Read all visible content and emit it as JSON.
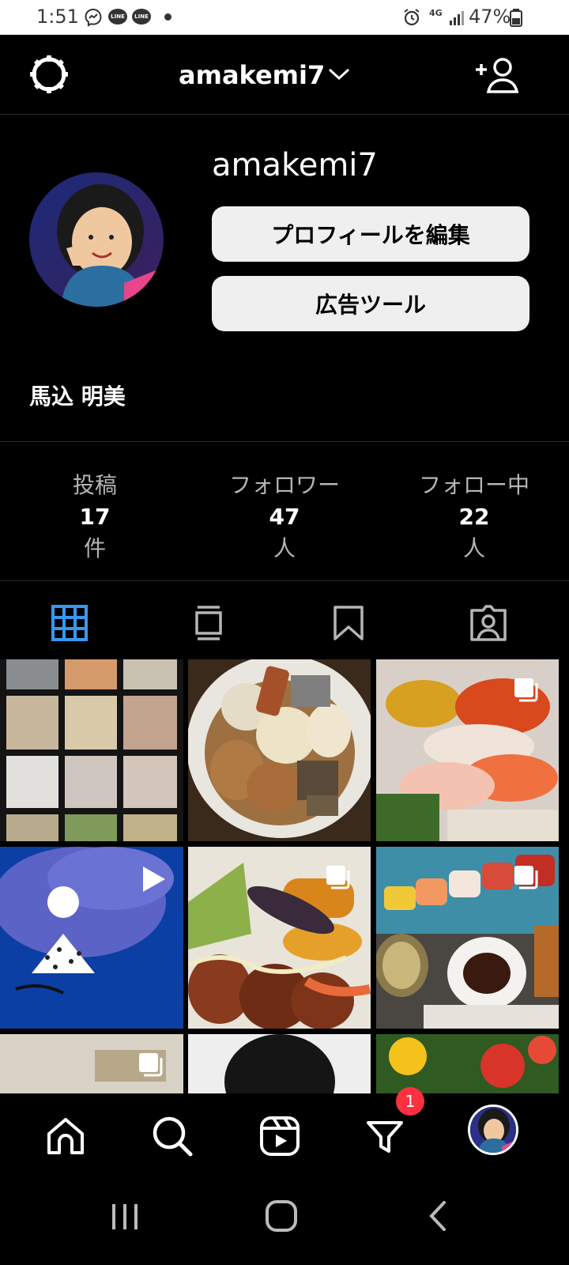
{
  "status_bar": {
    "time": "1:51",
    "notification_icons": [
      "messenger-icon",
      "line-icon",
      "line-icon"
    ],
    "line_label": "LINE",
    "network": "4G",
    "battery": "47%"
  },
  "header": {
    "username": "amakemi7"
  },
  "profile": {
    "username": "amakemi7",
    "edit_profile_label": "プロフィールを編集",
    "ad_tools_label": "広告ツール",
    "full_name": "馬込 明美"
  },
  "stats": [
    {
      "label": "投稿",
      "count": "17",
      "unit": "件"
    },
    {
      "label": "フォロワー",
      "count": "47",
      "unit": "人"
    },
    {
      "label": "フォロー中",
      "count": "22",
      "unit": "人"
    }
  ],
  "tabs": [
    "grid-icon",
    "igtv-icon",
    "bookmark-icon",
    "tagged-icon"
  ],
  "colors": {
    "accent": "#3897f0",
    "badge": "#ff3040",
    "background": "#000000"
  },
  "nav": {
    "items": [
      "home-icon",
      "search-icon",
      "reels-icon",
      "activity-icon",
      "profile-avatar"
    ],
    "activity_badge": "1"
  }
}
